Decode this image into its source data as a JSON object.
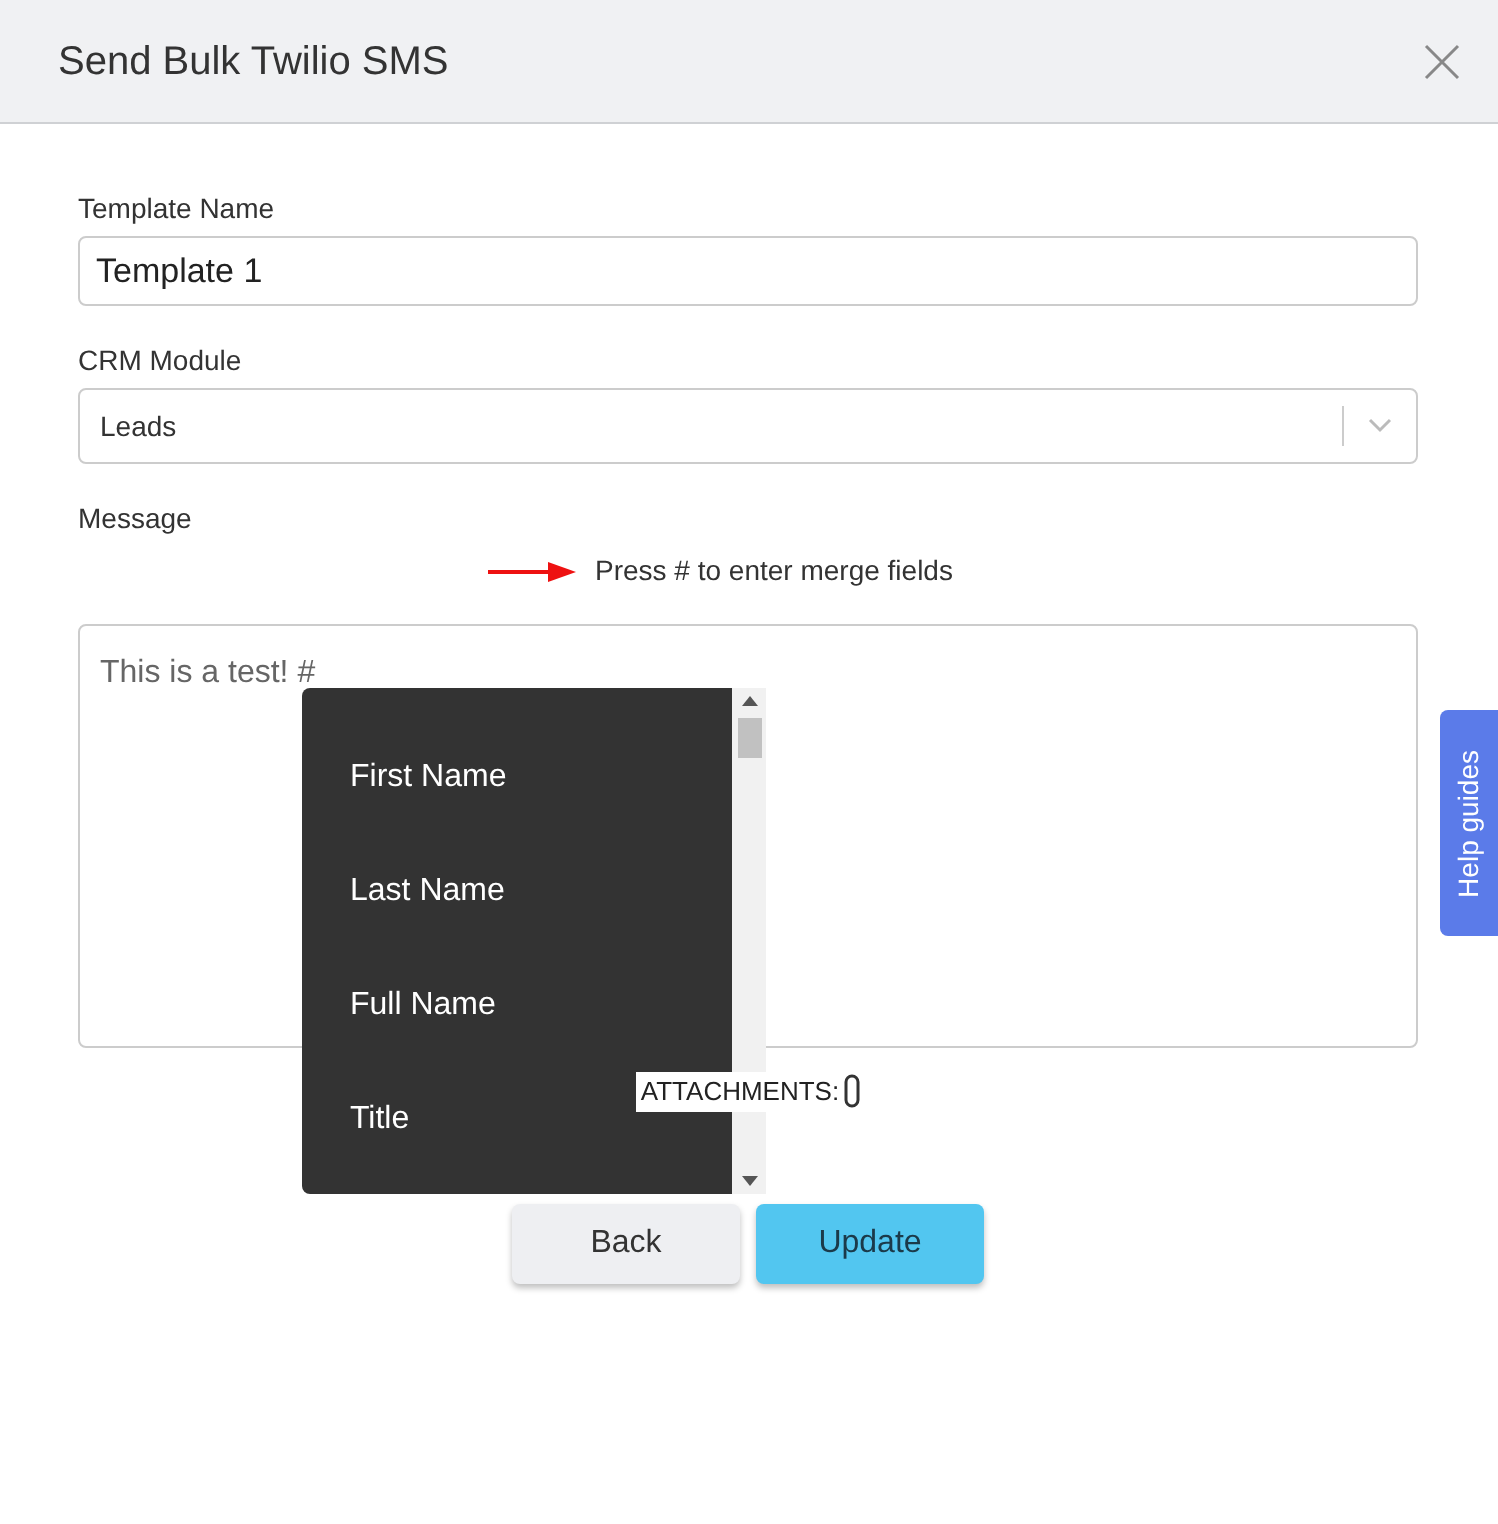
{
  "dialog": {
    "title": "Send Bulk Twilio SMS"
  },
  "fields": {
    "template_name": {
      "label": "Template Name",
      "value": "Template 1"
    },
    "crm_module": {
      "label": "CRM Module",
      "value": "Leads"
    },
    "message": {
      "label": "Message",
      "hint": "Press # to enter merge fields",
      "value": "This is a test! #"
    }
  },
  "merge_fields": [
    "First Name",
    "Last Name",
    "Full Name",
    "Title"
  ],
  "attachments_label": "ATTACHMENTS:",
  "buttons": [
    {
      "label": "Back",
      "kind": "secondary"
    },
    {
      "label": "Update",
      "kind": "primary"
    }
  ],
  "help_tab": "Help guides"
}
